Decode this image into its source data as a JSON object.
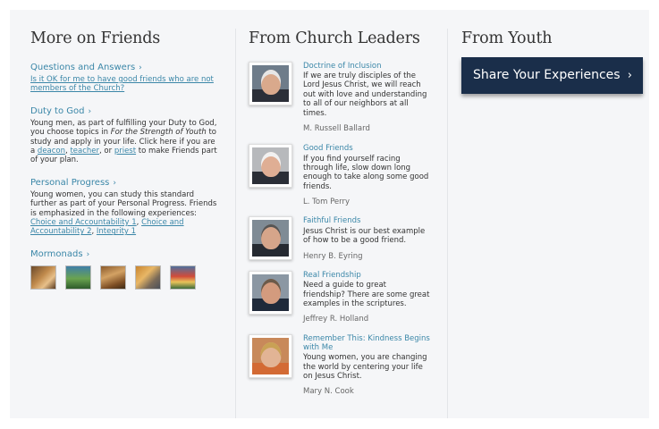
{
  "col1": {
    "heading": "More on Friends",
    "qa": {
      "title": "Questions and Answers",
      "link": "Is it OK for me to have good friends who are not members of the Church?"
    },
    "duty": {
      "title": "Duty to God",
      "text_a": "Young men, as part of fulfilling your Duty to God, you choose topics in ",
      "text_italic": "For the Strength of Youth",
      "text_b": " to study and apply in your life. Click here if you are a ",
      "deacon": "deacon",
      "comma": ", ",
      "teacher": "teacher",
      "or": ", or ",
      "priest": "priest",
      "text_c": " to make Friends part of your plan."
    },
    "progress": {
      "title": "Personal Progress",
      "text": "Young women, you can study this standard further as part of your Personal Progress. Friends is emphasized in the following experiences: ",
      "link1": "Choice and Accountability 1",
      "sep": ", ",
      "link2": "Choice and Accountability 2",
      "link3": "Integrity 1"
    },
    "mormonads": {
      "title": "Mormonads"
    }
  },
  "col2": {
    "heading": "From Church Leaders",
    "leaders": [
      {
        "title": "Doctrine of Inclusion",
        "text": "If we are truly disciples of the Lord Jesus Christ, we will reach out with love and understanding to all of our neighbors at all times.",
        "name": "M. Russell Ballard"
      },
      {
        "title": "Good Friends",
        "text": "If you find yourself racing through life, slow down long enough to take along some good friends.",
        "name": "L. Tom Perry"
      },
      {
        "title": "Faithful Friends",
        "text": "Jesus Christ is our best example of how to be a good friend.",
        "name": "Henry B. Eyring"
      },
      {
        "title": "Real Friendship",
        "text": "Need a guide to great friendship? There are some great examples in the scriptures.",
        "name": "Jeffrey R. Holland"
      },
      {
        "title": "Remember This: Kindness Begins with Me",
        "text": "Young women, you are changing the world by centering your life on Jesus Christ.",
        "name": "Mary N. Cook"
      }
    ]
  },
  "col3": {
    "heading": "From Youth",
    "cta": "Share Your Experiences"
  },
  "icons": {
    "chevron": "›"
  },
  "colors": {
    "link": "#3b87a8",
    "cta_bg": "#1a2e4a",
    "panel_bg": "#f5f6f8"
  }
}
